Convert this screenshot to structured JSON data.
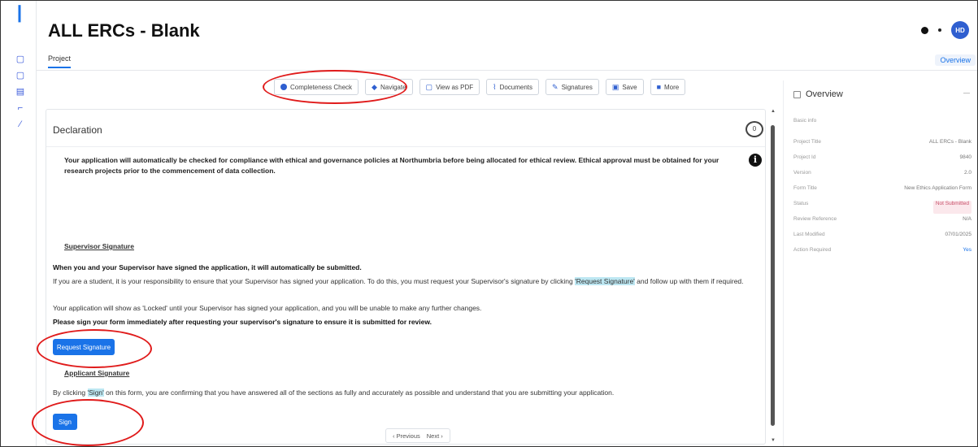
{
  "header": {
    "title": "ALL ERCs - Blank",
    "avatar_initials": "HD"
  },
  "tabs": {
    "project": "Project",
    "overview": "Overview"
  },
  "toolbar": {
    "completeness": "Completeness Check",
    "navigate": "Navigate",
    "view_pdf": "View as PDF",
    "documents": "Documents",
    "signatures": "Signatures",
    "save": "Save",
    "more": "More"
  },
  "card": {
    "title": "Declaration",
    "comment_count": "0",
    "intro": "Your application will automatically be checked for compliance with ethical and governance policies at Northumbria before being allocated for ethical review. Ethical approval must be obtained for your research projects prior to the commencement of data collection.",
    "supervisor_heading": "Supervisor Signature",
    "supervisor_bold": "When you and your Supervisor have signed the application, it will automatically be submitted.",
    "supervisor_p_before": "If you are a student, it is your responsibility to ensure that your Supervisor has signed your application. To do this, you must request your Supervisor's signature by clicking ",
    "supervisor_p_highlight": "'Request Signature'",
    "supervisor_p_after": " and follow up with them if required.",
    "locked_note": "Your application will show as 'Locked' until your Supervisor has signed your application, and you will be unable to make any further changes.",
    "please_sign": "Please sign your form immediately after requesting your supervisor's signature to ensure it is submitted for review.",
    "request_button": "Request Signature",
    "applicant_heading": "Applicant Signature",
    "applicant_p_before": "By clicking ",
    "applicant_p_highlight": "'Sign'",
    "applicant_p_after": " on this form, you are confirming that you have answered all of the sections as fully and accurately as possible and understand that you are submitting your application.",
    "sign_button": "Sign",
    "prev": "‹ Previous",
    "next": "Next ›"
  },
  "overview": {
    "title": "Overview",
    "subtitle": "Basic info",
    "rows": [
      {
        "label": "Project Title",
        "value": "ALL ERCs - Blank"
      },
      {
        "label": "Project Id",
        "value": "9840"
      },
      {
        "label": "Version",
        "value": "2.0"
      },
      {
        "label": "Form Title",
        "value": "New Ethics Application Form"
      },
      {
        "label": "Status",
        "value": "Not Submitted"
      },
      {
        "label": "Review Reference",
        "value": "N/A"
      },
      {
        "label": "Last Modified",
        "value": "07/01/2025"
      },
      {
        "label": "Action Required",
        "value": "Yes"
      }
    ]
  },
  "colors": {
    "accent": "#1a73e8",
    "annotation": "#e01b1b"
  }
}
